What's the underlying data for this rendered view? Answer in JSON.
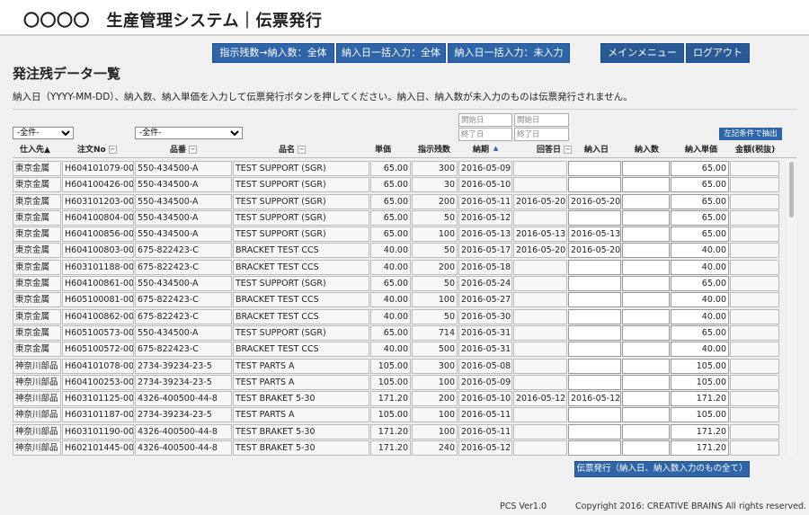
{
  "header": {
    "title": "〇〇〇〇　生産管理システム｜伝票発行"
  },
  "toolbar": {
    "copy_remaining": "指示残数→納入数：全体",
    "bulk_date_all": "納入日一括入力：全体",
    "bulk_date_empty": "納入日一括入力：未入力",
    "main_menu": "メインメニュー",
    "logout": "ログアウト"
  },
  "page": {
    "title": "発注残データ一覧",
    "instructions": "納入日（YYYY-MM-DD）、納入数、納入単価を入力して伝票発行ボタンを押してください。納入日、納入数が未入力のものは伝票発行されません。"
  },
  "filters": {
    "supplier_selected": "-全件-",
    "part_selected": "-全件-",
    "due_start_placeholder": "開始日",
    "due_end_placeholder": "終了日",
    "reply_start_placeholder": "開始日",
    "reply_end_placeholder": "終了日",
    "extract_label": "左記条件で抽出"
  },
  "columns": {
    "supplier": "仕入先▲",
    "order_no": "注文No",
    "part_no": "品番",
    "part_name": "品名",
    "unit_price": "単価",
    "remaining": "指示残数",
    "due_date": "納期",
    "reply_date": "回答日",
    "delivery_date": "納入日",
    "delivery_qty": "納入数",
    "delivery_price": "納入単価",
    "amount": "金額(税抜)"
  },
  "rows": [
    {
      "supplier": "東京金属",
      "order_no": "H604101079-00",
      "part_no": "550-434500-A",
      "part_name": "TEST SUPPORT (SGR)",
      "unit_price": "65.00",
      "remaining": "300",
      "due_date": "2016-05-09",
      "reply_date": "",
      "delivery_date": "",
      "delivery_qty": "",
      "delivery_price": "65.00",
      "amount": ""
    },
    {
      "supplier": "東京金属",
      "order_no": "H604100426-00",
      "part_no": "550-434500-A",
      "part_name": "TEST SUPPORT (SGR)",
      "unit_price": "65.00",
      "remaining": "30",
      "due_date": "2016-05-10",
      "reply_date": "",
      "delivery_date": "",
      "delivery_qty": "",
      "delivery_price": "65.00",
      "amount": ""
    },
    {
      "supplier": "東京金属",
      "order_no": "H603101203-00",
      "part_no": "550-434500-A",
      "part_name": "TEST SUPPORT (SGR)",
      "unit_price": "65.00",
      "remaining": "200",
      "due_date": "2016-05-11",
      "reply_date": "2016-05-20",
      "delivery_date": "2016-05-20",
      "delivery_qty": "",
      "delivery_price": "65.00",
      "amount": ""
    },
    {
      "supplier": "東京金属",
      "order_no": "H604100804-00",
      "part_no": "550-434500-A",
      "part_name": "TEST SUPPORT (SGR)",
      "unit_price": "65.00",
      "remaining": "50",
      "due_date": "2016-05-12",
      "reply_date": "",
      "delivery_date": "",
      "delivery_qty": "",
      "delivery_price": "65.00",
      "amount": ""
    },
    {
      "supplier": "東京金属",
      "order_no": "H604100856-00",
      "part_no": "550-434500-A",
      "part_name": "TEST SUPPORT (SGR)",
      "unit_price": "65.00",
      "remaining": "100",
      "due_date": "2016-05-13",
      "reply_date": "2016-05-13",
      "delivery_date": "2016-05-13",
      "delivery_qty": "",
      "delivery_price": "65.00",
      "amount": ""
    },
    {
      "supplier": "東京金属",
      "order_no": "H604100803-00",
      "part_no": "675-822423-C",
      "part_name": "BRACKET TEST CCS",
      "unit_price": "40.00",
      "remaining": "50",
      "due_date": "2016-05-17",
      "reply_date": "2016-05-20",
      "delivery_date": "2016-05-20",
      "delivery_qty": "",
      "delivery_price": "40.00",
      "amount": ""
    },
    {
      "supplier": "東京金属",
      "order_no": "H603101188-00",
      "part_no": "675-822423-C",
      "part_name": "BRACKET TEST CCS",
      "unit_price": "40.00",
      "remaining": "200",
      "due_date": "2016-05-18",
      "reply_date": "",
      "delivery_date": "",
      "delivery_qty": "",
      "delivery_price": "40.00",
      "amount": ""
    },
    {
      "supplier": "東京金属",
      "order_no": "H604100861-00",
      "part_no": "550-434500-A",
      "part_name": "TEST SUPPORT (SGR)",
      "unit_price": "65.00",
      "remaining": "50",
      "due_date": "2016-05-24",
      "reply_date": "",
      "delivery_date": "",
      "delivery_qty": "",
      "delivery_price": "65.00",
      "amount": ""
    },
    {
      "supplier": "東京金属",
      "order_no": "H605100081-00",
      "part_no": "675-822423-C",
      "part_name": "BRACKET TEST CCS",
      "unit_price": "40.00",
      "remaining": "100",
      "due_date": "2016-05-27",
      "reply_date": "",
      "delivery_date": "",
      "delivery_qty": "",
      "delivery_price": "40.00",
      "amount": ""
    },
    {
      "supplier": "東京金属",
      "order_no": "H604100862-00",
      "part_no": "675-822423-C",
      "part_name": "BRACKET TEST CCS",
      "unit_price": "40.00",
      "remaining": "50",
      "due_date": "2016-05-30",
      "reply_date": "",
      "delivery_date": "",
      "delivery_qty": "",
      "delivery_price": "40.00",
      "amount": ""
    },
    {
      "supplier": "東京金属",
      "order_no": "H605100573-00",
      "part_no": "550-434500-A",
      "part_name": "TEST SUPPORT (SGR)",
      "unit_price": "65.00",
      "remaining": "714",
      "due_date": "2016-05-31",
      "reply_date": "",
      "delivery_date": "",
      "delivery_qty": "",
      "delivery_price": "65.00",
      "amount": ""
    },
    {
      "supplier": "東京金属",
      "order_no": "H605100572-00",
      "part_no": "675-822423-C",
      "part_name": "BRACKET TEST CCS",
      "unit_price": "40.00",
      "remaining": "500",
      "due_date": "2016-05-31",
      "reply_date": "",
      "delivery_date": "",
      "delivery_qty": "",
      "delivery_price": "40.00",
      "amount": ""
    },
    {
      "supplier": "神奈川部品",
      "order_no": "H604101078-00",
      "part_no": "2734-39234-23-5",
      "part_name": "TEST PARTS A",
      "unit_price": "105.00",
      "remaining": "300",
      "due_date": "2016-05-08",
      "reply_date": "",
      "delivery_date": "",
      "delivery_qty": "",
      "delivery_price": "105.00",
      "amount": ""
    },
    {
      "supplier": "神奈川部品",
      "order_no": "H604100253-00",
      "part_no": "2734-39234-23-5",
      "part_name": "TEST PARTS A",
      "unit_price": "105.00",
      "remaining": "100",
      "due_date": "2016-05-09",
      "reply_date": "",
      "delivery_date": "",
      "delivery_qty": "",
      "delivery_price": "105.00",
      "amount": ""
    },
    {
      "supplier": "神奈川部品",
      "order_no": "H603101125-00",
      "part_no": "4326-400500-44-8",
      "part_name": "TEST BRAKET 5-30",
      "unit_price": "171.20",
      "remaining": "200",
      "due_date": "2016-05-10",
      "reply_date": "2016-05-12",
      "delivery_date": "2016-05-12",
      "delivery_qty": "",
      "delivery_price": "171.20",
      "amount": ""
    },
    {
      "supplier": "神奈川部品",
      "order_no": "H603101187-00",
      "part_no": "2734-39234-23-5",
      "part_name": "TEST PARTS A",
      "unit_price": "105.00",
      "remaining": "100",
      "due_date": "2016-05-11",
      "reply_date": "",
      "delivery_date": "",
      "delivery_qty": "",
      "delivery_price": "105.00",
      "amount": ""
    },
    {
      "supplier": "神奈川部品",
      "order_no": "H603101190-00",
      "part_no": "4326-400500-44-8",
      "part_name": "TEST BRAKET 5-30",
      "unit_price": "171.20",
      "remaining": "100",
      "due_date": "2016-05-11",
      "reply_date": "",
      "delivery_date": "",
      "delivery_qty": "",
      "delivery_price": "171.20",
      "amount": ""
    },
    {
      "supplier": "神奈川部品",
      "order_no": "H602101445-00",
      "part_no": "4326-400500-44-8",
      "part_name": "TEST BRAKET 5-30",
      "unit_price": "171.20",
      "remaining": "240",
      "due_date": "2016-05-12",
      "reply_date": "",
      "delivery_date": "",
      "delivery_qty": "",
      "delivery_price": "171.20",
      "amount": ""
    }
  ],
  "issue_button": "伝票発行（納入日、納入数入力のもの全て）",
  "footer": {
    "version": "PCS Ver1.0",
    "copyright": "Copyright 2016: CREATIVE BRAINS All rights reserved."
  }
}
